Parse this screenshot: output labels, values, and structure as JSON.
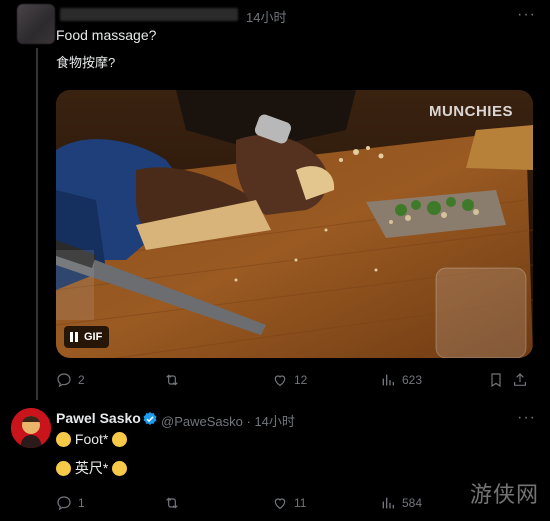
{
  "tweet": {
    "time": "14小时",
    "more": "···",
    "text_en": "Food massage?",
    "text_zh": "食物按摩?",
    "media": {
      "brand": "MUNCHIES",
      "badge": "GIF"
    },
    "actions": {
      "replies": "2",
      "retweets": "",
      "likes": "12",
      "views": "623"
    }
  },
  "reply": {
    "name": "Pawel Sasko",
    "handle": "@PaweSasko",
    "separator": "·",
    "time": "14小时",
    "more": "···",
    "line1": "Foot*",
    "line2": "英尺*",
    "actions": {
      "replies": "1",
      "retweets": "",
      "likes": "11",
      "views": "584"
    }
  },
  "watermark": "游侠网",
  "colors": {
    "accent_blue": "#1d9bf0",
    "muted": "#71767b",
    "text": "#e7e9ea"
  }
}
